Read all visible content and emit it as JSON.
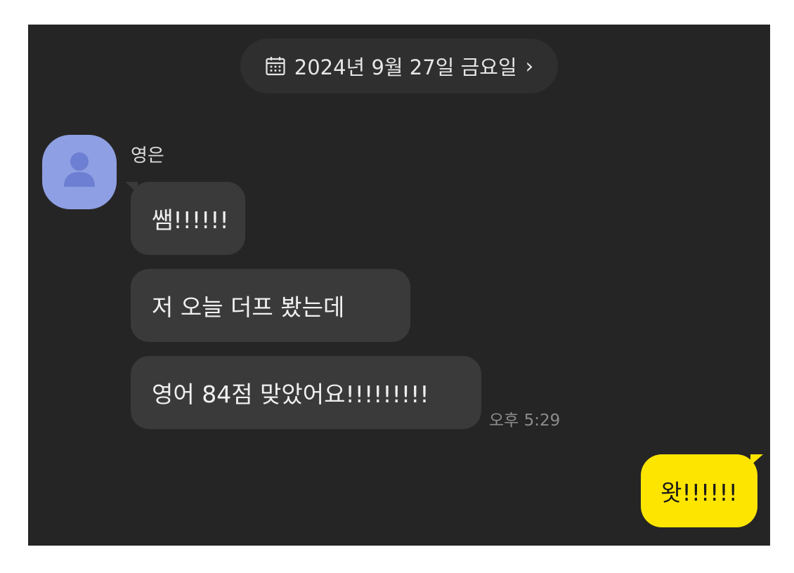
{
  "date_header": {
    "label": "2024년 9월 27일 금요일",
    "chevron": "›",
    "icon": "calendar-icon"
  },
  "incoming": {
    "sender": "영은",
    "avatar_icon": "person-icon",
    "avatar_color": "#8f9fe3",
    "messages": [
      "쌤!!!!!!",
      "저 오늘 더프 봤는데",
      "영어 84점 맞았어요!!!!!!!!!"
    ],
    "time": "오후 5:29"
  },
  "outgoing": {
    "messages": [
      "왓!!!!!!"
    ],
    "bubble_color": "#fee500"
  }
}
